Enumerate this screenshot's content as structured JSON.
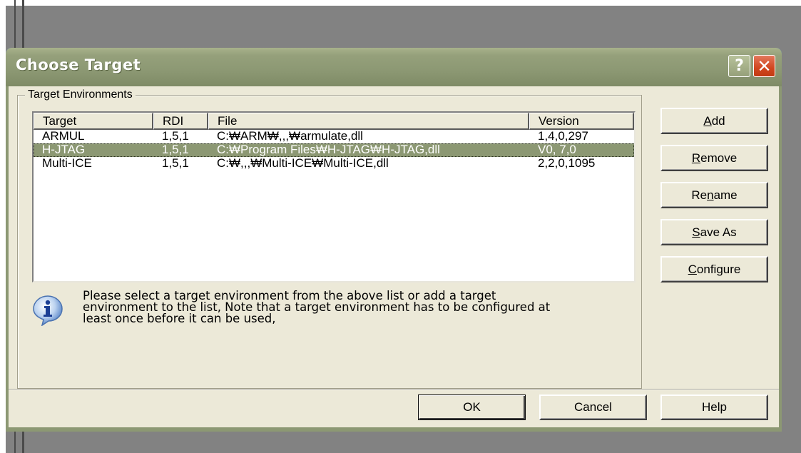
{
  "window": {
    "title": "Choose Target"
  },
  "groupbox": {
    "label": "Target Environments"
  },
  "list": {
    "columns": [
      "Target",
      "RDI",
      "File",
      "Version"
    ],
    "rows": [
      {
        "target": "ARMUL",
        "rdi": "1,5,1",
        "file": "C:₩ARM₩,,,₩armulate,dll",
        "version": "1,4,0,297"
      },
      {
        "target": "H-JTAG",
        "rdi": "1,5,1",
        "file": "C:₩Program Files₩H-JTAG₩H-JTAG,dll",
        "version": "V0, 7,0"
      },
      {
        "target": "Multi-ICE",
        "rdi": "1,5,1",
        "file": "C:₩,,,₩Multi-ICE₩Multi-ICE,dll",
        "version": "2,2,0,1095"
      }
    ],
    "selected_index": 1
  },
  "info": {
    "icon": "info-icon",
    "line1": "Please select a target environment from the above list or add a target",
    "line2": "environment to the list, Note that a target environment has to be configured at",
    "line3": "least once before it can be used,"
  },
  "buttons": {
    "add": {
      "pre": "",
      "ul": "A",
      "post": "dd"
    },
    "remove": {
      "pre": "",
      "ul": "R",
      "post": "emove"
    },
    "rename": {
      "pre": "Re",
      "ul": "n",
      "post": "ame"
    },
    "saveas": {
      "pre": "",
      "ul": "S",
      "post": "ave As"
    },
    "configure": {
      "pre": "",
      "ul": "C",
      "post": "onfigure"
    },
    "ok": "OK",
    "cancel": "Cancel",
    "help": "Help"
  },
  "titlebar_buttons": {
    "help": "?",
    "close": "✕"
  },
  "colors": {
    "titlebar": "#8c9873",
    "selection": "#8c9873",
    "dialog_bg": "#ece9d8",
    "backdrop": "#828282",
    "close_button": "#d1461f"
  }
}
